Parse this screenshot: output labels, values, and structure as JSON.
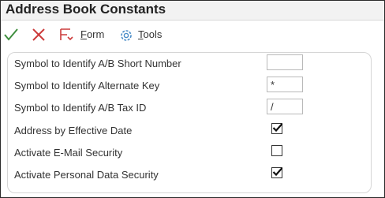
{
  "window": {
    "title": "Address Book Constants"
  },
  "toolbar": {
    "ok_icon": "checkmark-icon",
    "cancel_icon": "close-icon",
    "form": {
      "accesskey": "F",
      "rest": "orm",
      "icon": "form-icon"
    },
    "tools": {
      "accesskey": "T",
      "rest": "ools",
      "icon": "gear-icon"
    }
  },
  "colors": {
    "ok": "#3f8f3f",
    "cancel": "#cc3b3b",
    "form_icon": "#cc3b3b",
    "tools_icon": "#4a8dc8"
  },
  "fields": [
    {
      "label": "Symbol to Identify A/B Short Number",
      "type": "text",
      "value": ""
    },
    {
      "label": "Symbol to Identify Alternate Key",
      "type": "text",
      "value": "*"
    },
    {
      "label": "Symbol to Identify A/B Tax ID",
      "type": "text",
      "value": "/"
    },
    {
      "label": "Address by Effective Date",
      "type": "checkbox",
      "checked": true
    },
    {
      "label": "Activate E-Mail Security",
      "type": "checkbox",
      "checked": false
    },
    {
      "label": "Activate Personal Data Security",
      "type": "checkbox",
      "checked": true
    }
  ]
}
